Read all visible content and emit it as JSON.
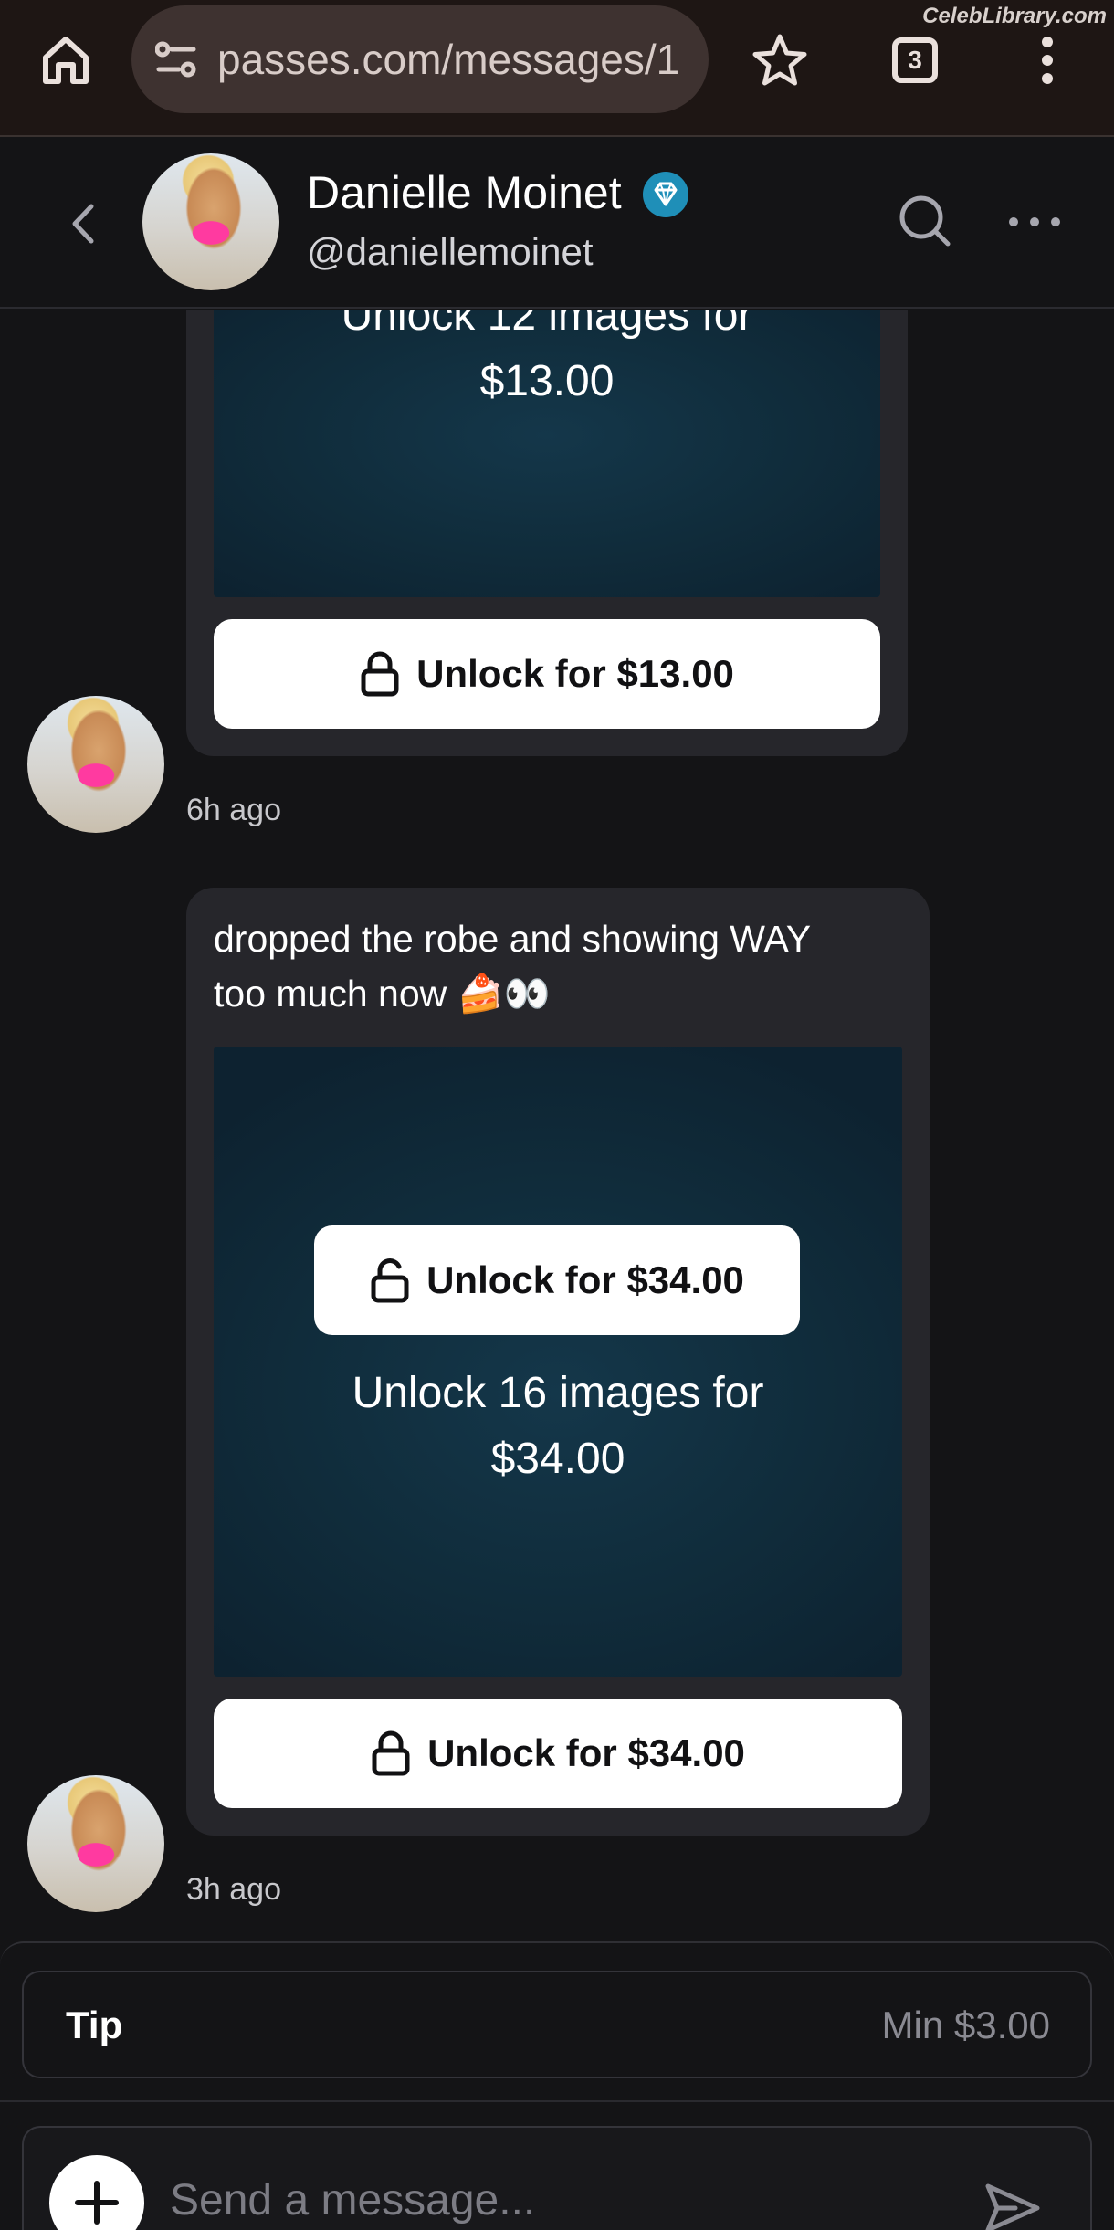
{
  "browser": {
    "url": "passes.com/messages/1",
    "tab_count": "3",
    "watermark": "CelebLibrary.com"
  },
  "chat_header": {
    "display_name": "Danielle Moinet",
    "handle": "@daniellemoinet",
    "verified": true
  },
  "messages": [
    {
      "media_caption_line1": "Unlock 12 images for",
      "media_caption_line2": "$13.00",
      "unlock_button_label": "Unlock for $13.00",
      "timestamp": "6h ago"
    },
    {
      "text_line1": "dropped the robe and showing WAY",
      "text_line2": "too much now",
      "text_emoji": "🍰👀",
      "overlay_unlock_label": "Unlock for $34.00",
      "media_caption_line1": "Unlock 16 images for",
      "media_caption_line2": "$34.00",
      "unlock_button_label": "Unlock for $34.00",
      "timestamp": "3h ago"
    }
  ],
  "composer": {
    "tip_label": "Tip",
    "tip_placeholder": "Min $3.00",
    "message_placeholder": "Send a message..."
  },
  "colors": {
    "background": "#141416",
    "bubble": "#26262b",
    "media": "#102c3b",
    "verified_badge": "#1f8fb8",
    "browser_bar": "#1e1614"
  }
}
